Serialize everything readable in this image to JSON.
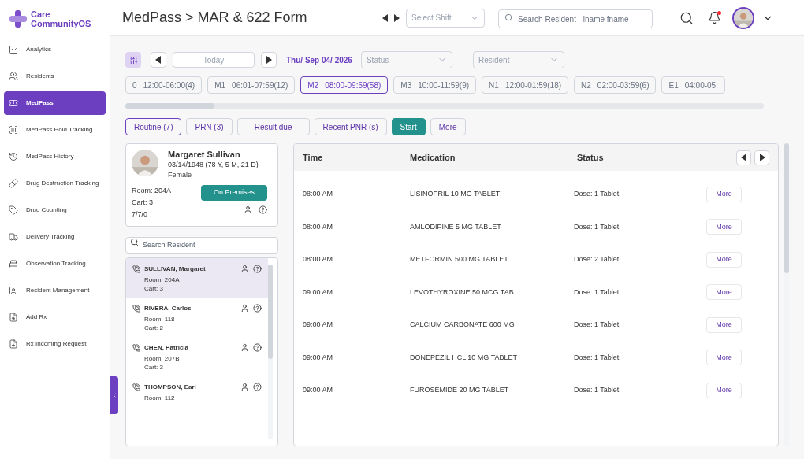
{
  "brand": {
    "line1": "Care",
    "line2": "CommunityOS"
  },
  "sidebar": {
    "items": [
      {
        "label": "Analytics",
        "selected": false
      },
      {
        "label": "Residents",
        "selected": false
      },
      {
        "label": "MedPass",
        "selected": true
      },
      {
        "label": "MedPass Hold Tracking",
        "selected": false
      },
      {
        "label": "MedPass History",
        "selected": false
      },
      {
        "label": "Drug Destruction Tracking",
        "selected": false
      },
      {
        "label": "Drug Counting",
        "selected": false
      },
      {
        "label": "Delivery Tracking",
        "selected": false
      },
      {
        "label": "Observation Tracking",
        "selected": false
      },
      {
        "label": "Resident Management",
        "selected": false
      },
      {
        "label": "Add Rx",
        "selected": false
      },
      {
        "label": "Rx Incoming Request",
        "selected": false
      }
    ]
  },
  "header": {
    "title": "MedPass > MAR & 622 Form",
    "shift_select": {
      "placeholder": "Select Shift"
    },
    "search": {
      "placeholder": "Search Resident - lname fname"
    }
  },
  "toolbar": {
    "today": "Today",
    "date": "Thu/ Sep 04/ 2026",
    "status_select": {
      "placeholder": "Status"
    },
    "resident_select": {
      "placeholder": "Resident"
    }
  },
  "shifts": [
    {
      "code": "0",
      "range": "12:00-06:00(4)",
      "selected": false
    },
    {
      "code": "M1",
      "range": "06:01-07:59(12)",
      "selected": false
    },
    {
      "code": "M2",
      "range": "08:00-09:59(58)",
      "selected": true
    },
    {
      "code": "M3",
      "range": "10:00-11:59(9)",
      "selected": false
    },
    {
      "code": "N1",
      "range": "12:00-01:59(18)",
      "selected": false
    },
    {
      "code": "N2",
      "range": "02:00-03:59(6)",
      "selected": false
    },
    {
      "code": "E1",
      "range": "04:00-05:",
      "selected": false
    }
  ],
  "actions": [
    {
      "label": "Routine (7)",
      "kind": "outline",
      "selected": true
    },
    {
      "label": "PRN (3)",
      "kind": "outline",
      "selected": false
    },
    {
      "label": "Result due",
      "kind": "outline",
      "selected": false
    },
    {
      "label": "Recent PNR (s)",
      "kind": "outline",
      "selected": false
    },
    {
      "label": "Start",
      "kind": "primary",
      "selected": false
    },
    {
      "label": "More",
      "kind": "outline",
      "selected": false
    }
  ],
  "resident_card": {
    "name": "Margaret Sullivan",
    "dob": "03/14/1948 (78 Y, 5 M, 21 D)",
    "gender": "Female",
    "room": "Room: 204A",
    "cart": "Cart: 3",
    "counts": "7/7/0",
    "badge": "On Premises"
  },
  "resident_search": {
    "placeholder": "Search Resident"
  },
  "residents": [
    {
      "name": "SULLIVAN, Margaret",
      "room": "Room: 204A",
      "cart": "Cart: 3",
      "selected": true
    },
    {
      "name": "RIVERA, Carlos",
      "room": "Room: 118",
      "cart": "Cart: 2",
      "selected": false
    },
    {
      "name": "CHEN, Patricia",
      "room": "Room: 207B",
      "cart": "Cart: 3",
      "selected": false
    },
    {
      "name": "THOMPSON, Earl",
      "room": "Room: 112",
      "selected": false
    }
  ],
  "table": {
    "columns": [
      "Time",
      "Medication",
      "Status"
    ],
    "rows": [
      {
        "time": "08:00 AM",
        "medication": "LISINOPRIL 10 MG TABLET",
        "status": "Dose: 1 Tablet",
        "action": "More"
      },
      {
        "time": "08:00 AM",
        "medication": "AMLODIPINE 5 MG TABLET",
        "status": "Dose: 1 Tablet",
        "action": "More"
      },
      {
        "time": "08:00 AM",
        "medication": "METFORMIN 500 MG TABLET",
        "status": "Dose: 2 Tablet",
        "action": "More"
      },
      {
        "time": "09:00 AM",
        "medication": "LEVOTHYROXINE 50 MCG TAB",
        "status": "Dose: 1 Tablet",
        "action": "More"
      },
      {
        "time": "09:00 AM",
        "medication": "CALCIUM CARBONATE 600 MG",
        "status": "Dose: 1 Tablet",
        "action": "More"
      },
      {
        "time": "09:00 AM",
        "medication": "DONEPEZIL HCL 10 MG TABLET",
        "status": "Dose: 1 Tablet",
        "action": "More"
      },
      {
        "time": "09:00 AM",
        "medication": "FUROSEMIDE 20 MG TABLET",
        "status": "Dose: 1 Tablet",
        "action": "More"
      }
    ]
  }
}
